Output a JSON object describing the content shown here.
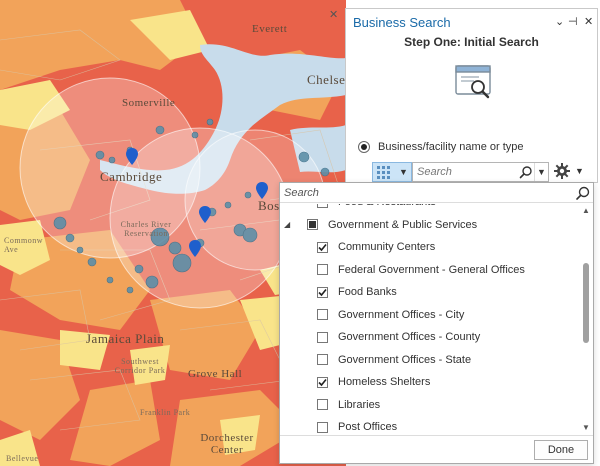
{
  "map": {
    "labels": {
      "everett": "Everett",
      "chelsea": "Chelse",
      "somerville": "Somerville",
      "cambridge": "Cambridge",
      "boston": "Boston",
      "charles_river": "Charles River Reservation",
      "commonwealth": "Commonw Ave",
      "jamaica_plain": "Jamaica Plain",
      "southwest_corridor": "Southwest Corridor Park",
      "grove_hall": "Grove Hall",
      "franklin_park": "Franklin Park",
      "dorchester_center": "Dorchester Center",
      "bellevue": "Bellevue"
    },
    "colors": {
      "high": "#e8624a",
      "mid": "#f2a35a",
      "low": "#f9e48a",
      "water": "#c8dceb",
      "buffer": "#ffffff",
      "point": "#5d8fa8",
      "pin": "#1f5fcc"
    }
  },
  "window": {
    "close_label": "✕"
  },
  "panel": {
    "title": "Business Search",
    "controls": {
      "menu": "⌄",
      "pin": "⊣",
      "close": "✕"
    },
    "step_title": "Step One: Initial Search",
    "radio_label": "Business/facility name or type",
    "search_placeholder": "Search",
    "accent": "#1a6aa8"
  },
  "dropdown": {
    "search_placeholder": "Search",
    "rows": [
      {
        "label": "Food & Restaurants",
        "state": "unchecked",
        "indent": "child"
      },
      {
        "label": "Government & Public Services",
        "state": "partial",
        "indent": "parent"
      },
      {
        "label": "Community Centers",
        "state": "checked",
        "indent": "child"
      },
      {
        "label": "Federal Government - General Offices",
        "state": "unchecked",
        "indent": "child"
      },
      {
        "label": "Food Banks",
        "state": "checked",
        "indent": "child"
      },
      {
        "label": "Government Offices - City",
        "state": "unchecked",
        "indent": "child"
      },
      {
        "label": "Government Offices - County",
        "state": "unchecked",
        "indent": "child"
      },
      {
        "label": "Government Offices - State",
        "state": "unchecked",
        "indent": "child"
      },
      {
        "label": "Homeless Shelters",
        "state": "checked",
        "indent": "child"
      },
      {
        "label": "Libraries",
        "state": "unchecked",
        "indent": "child"
      },
      {
        "label": "Post Offices",
        "state": "unchecked",
        "indent": "child"
      }
    ],
    "done_label": "Done"
  }
}
